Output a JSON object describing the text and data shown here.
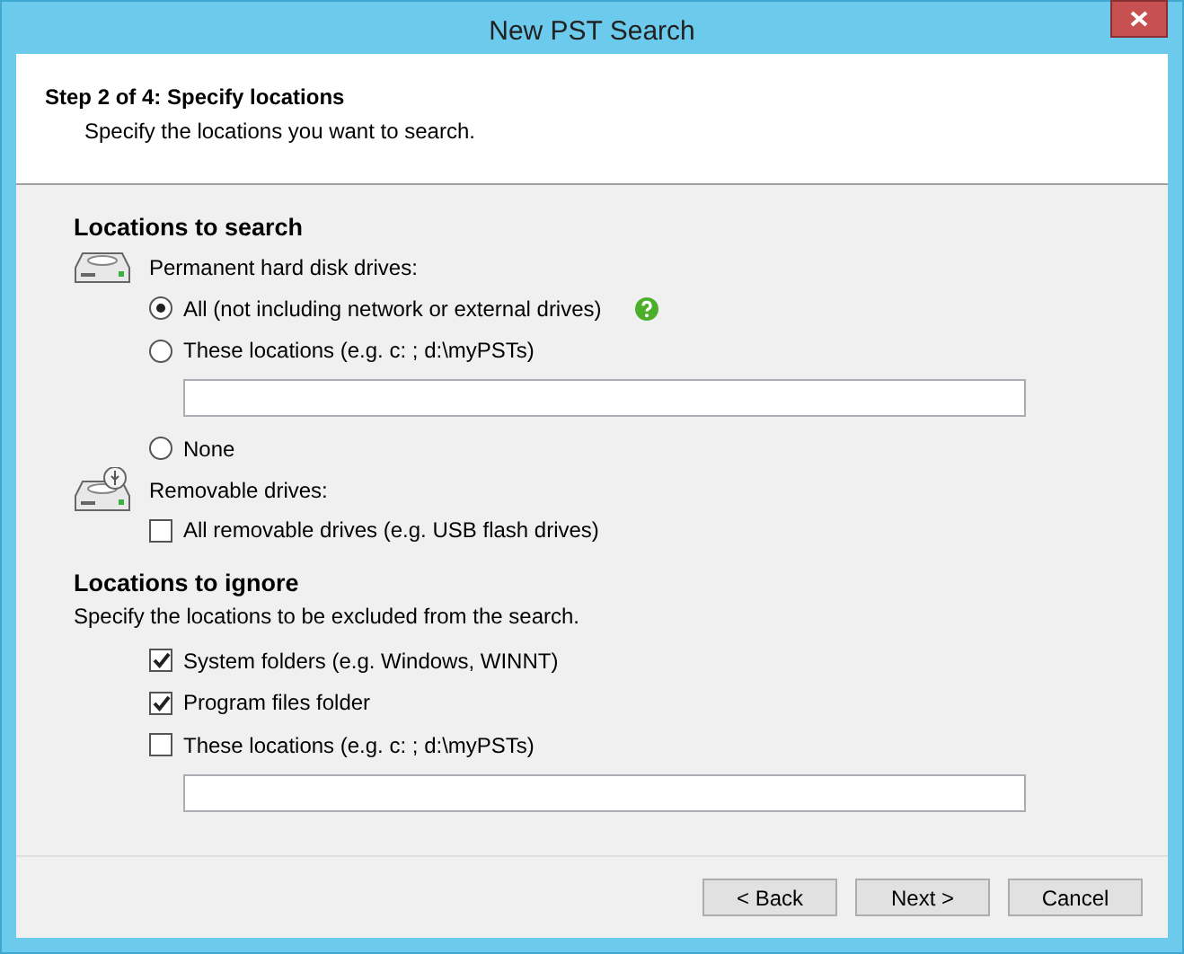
{
  "window": {
    "title": "New PST Search"
  },
  "header": {
    "step": "Step 2 of 4: Specify locations",
    "description": "Specify the locations you want to search."
  },
  "sections": [
    {
      "heading": "Locations to search",
      "groups": [
        {
          "kind": "disk",
          "label": "Permanent hard disk drives:",
          "options": [
            {
              "kind": "radio",
              "label": "All (not including network or external drives)",
              "selected": true,
              "help": true
            },
            {
              "kind": "radio",
              "label": "These locations (e.g. c: ; d:\\myPSTs)",
              "selected": false
            },
            {
              "kind": "field"
            },
            {
              "kind": "radio",
              "label": "None",
              "selected": false
            }
          ]
        },
        {
          "kind": "usb-disk",
          "label": "Removable drives:",
          "options": [
            {
              "kind": "checkbox",
              "label": "All removable drives (e.g. USB flash drives)",
              "checked": false
            }
          ]
        }
      ]
    },
    {
      "heading": "Locations to ignore",
      "description": "Specify the locations to be excluded from the search.",
      "groups": [
        {
          "options": [
            {
              "kind": "checkbox",
              "label": "System folders (e.g. Windows, WINNT)",
              "checked": true
            },
            {
              "kind": "checkbox",
              "label": "Program files folder",
              "checked": true
            },
            {
              "kind": "checkbox",
              "label": "These locations (e.g. c: ; d:\\myPSTs)",
              "checked": false
            },
            {
              "kind": "field"
            }
          ]
        }
      ]
    }
  ],
  "buttons": [
    "< Back",
    "Next >",
    "Cancel"
  ]
}
